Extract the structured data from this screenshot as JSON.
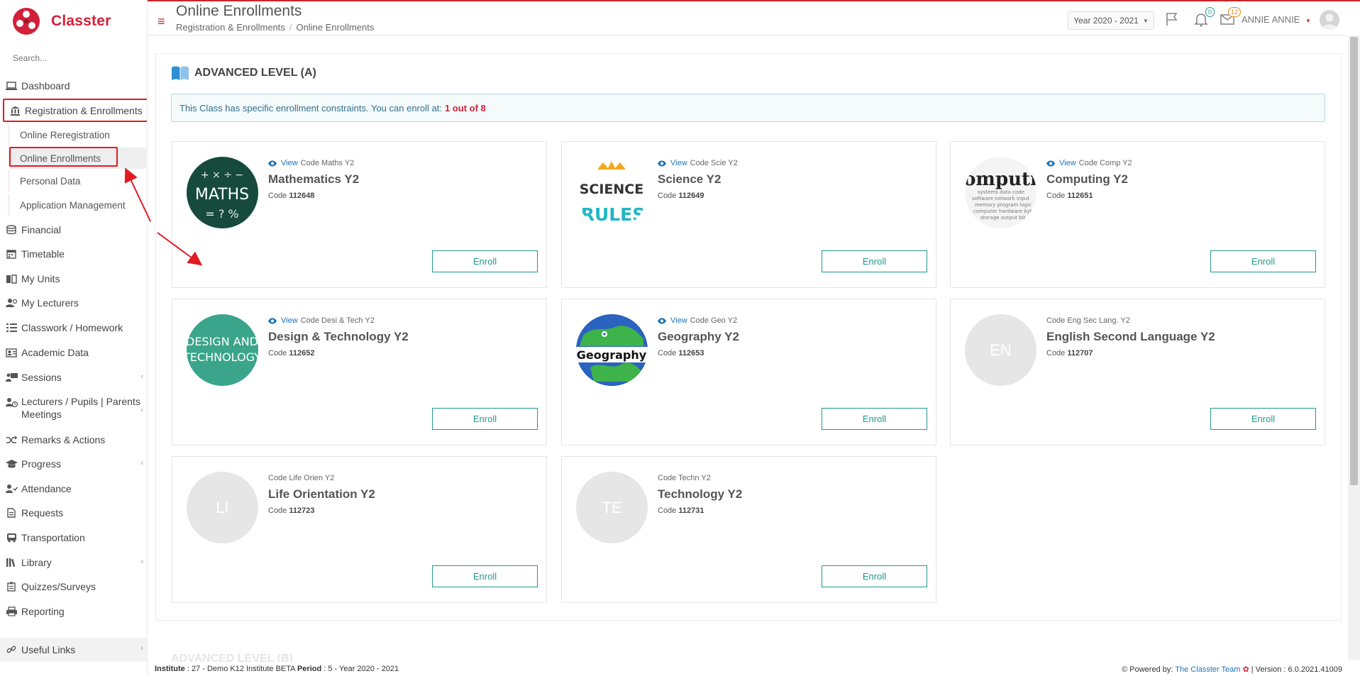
{
  "brand": {
    "name": "Classter"
  },
  "search": {
    "placeholder": "Search..."
  },
  "sidebar": {
    "items": [
      {
        "key": "dashboard",
        "label": "Dashboard",
        "icon": "laptop-icon"
      },
      {
        "key": "registration",
        "label": "Registration & Enrollments",
        "icon": "bank-icon"
      },
      {
        "key": "financial",
        "label": "Financial",
        "icon": "coins-icon"
      },
      {
        "key": "timetable",
        "label": "Timetable",
        "icon": "calendar-icon"
      },
      {
        "key": "my-units",
        "label": "My Units",
        "icon": "book-icon"
      },
      {
        "key": "my-lecturers",
        "label": "My Lecturers",
        "icon": "users-icon"
      },
      {
        "key": "classwork",
        "label": "Classwork / Homework",
        "icon": "tasks-icon"
      },
      {
        "key": "academic-data",
        "label": "Academic Data",
        "icon": "id-card-icon"
      },
      {
        "key": "sessions",
        "label": "Sessions",
        "icon": "presentation-icon"
      },
      {
        "key": "meetings",
        "label": "Lecturers / Pupils | Parents Meetings",
        "icon": "user-clock-icon"
      },
      {
        "key": "remarks",
        "label": "Remarks & Actions",
        "icon": "shuffle-icon"
      },
      {
        "key": "progress",
        "label": "Progress",
        "icon": "graduation-cap-icon"
      },
      {
        "key": "attendance",
        "label": "Attendance",
        "icon": "user-check-icon"
      },
      {
        "key": "requests",
        "label": "Requests",
        "icon": "file-icon"
      },
      {
        "key": "transportation",
        "label": "Transportation",
        "icon": "bus-icon"
      },
      {
        "key": "library",
        "label": "Library",
        "icon": "library-icon"
      },
      {
        "key": "quizzes",
        "label": "Quizzes/Surveys",
        "icon": "clipboard-icon"
      },
      {
        "key": "reporting",
        "label": "Reporting",
        "icon": "printer-icon"
      }
    ],
    "subitems": [
      {
        "label": "Online Reregistration"
      },
      {
        "label": "Online Enrollments",
        "active": true
      },
      {
        "label": "Personal Data"
      },
      {
        "label": "Application Management"
      }
    ],
    "useful_links": "Useful Links"
  },
  "header": {
    "title": "Online Enrollments",
    "breadcrumb": [
      "Registration & Enrollments",
      "Online Enrollments"
    ],
    "year": "Year 2020 - 2021",
    "notifications_count": "0",
    "messages_count": "12",
    "user": "ANNIE ANNIE"
  },
  "section": {
    "title": "ADVANCED LEVEL (A)",
    "alert_text": "This Class has specific enrollment constraints. You can enroll at:",
    "alert_count": "1 out of 8",
    "next_section_partial": "ADVANCED LEVEL (B)"
  },
  "cards": [
    {
      "view": "View",
      "code_label": "Code Maths Y2",
      "title": "Mathematics Y2",
      "code_prefix": "Code",
      "code": "112648",
      "enroll": "Enroll",
      "image": "maths"
    },
    {
      "view": "View",
      "code_label": "Code Scie Y2",
      "title": "Science Y2",
      "code_prefix": "Code",
      "code": "112649",
      "enroll": "Enroll",
      "image": "science"
    },
    {
      "view": "View",
      "code_label": "Code Comp Y2",
      "title": "Computing Y2",
      "code_prefix": "Code",
      "code": "112651",
      "enroll": "Enroll",
      "image": "computing"
    },
    {
      "view": "View",
      "code_label": "Code Desi & Tech Y2",
      "title": "Design & Technology Y2",
      "code_prefix": "Code",
      "code": "112652",
      "enroll": "Enroll",
      "image": "design"
    },
    {
      "view": "View",
      "code_label": "Code Geo Y2",
      "title": "Geography Y2",
      "code_prefix": "Code",
      "code": "112653",
      "enroll": "Enroll",
      "image": "geography"
    },
    {
      "code_label": "Code Eng Sec Lang. Y2",
      "title": "English Second Language Y2",
      "code_prefix": "Code",
      "code": "112707",
      "enroll": "Enroll",
      "initials": "EN"
    },
    {
      "code_label": "Code Life Orien Y2",
      "title": "Life Orientation Y2",
      "code_prefix": "Code",
      "code": "112723",
      "enroll": "Enroll",
      "initials": "LI"
    },
    {
      "code_label": "Code Techn Y2",
      "title": "Technology Y2",
      "code_prefix": "Code",
      "code": "112731",
      "enroll": "Enroll",
      "initials": "TE"
    }
  ],
  "image_text": {
    "maths": "MATHS",
    "science_top": "SCIENCE",
    "science_bottom": "RULES",
    "computing": "omputi",
    "design_top": "DESIGN AND",
    "design_bottom": "TECHNOLOGY",
    "geography": "Geography"
  },
  "footer": {
    "institute_label": "Institute",
    "institute_value": ": 27 - Demo K12 Institute BETA",
    "period_label": "Period",
    "period_value": ": 5 - Year 2020 - 2021",
    "powered_label": "Powered by:",
    "powered_link": "The Classter Team",
    "version": "| Version : 6.0.2021.41009"
  },
  "colors": {
    "brand": "#d3203a",
    "accent": "#20998e",
    "link": "#1a73b8",
    "highlight": "#e21b23"
  }
}
